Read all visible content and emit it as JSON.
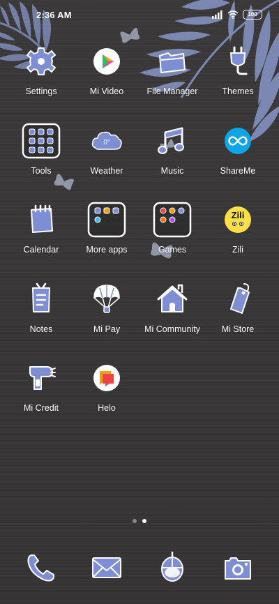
{
  "status_bar": {
    "time": "2:36 AM",
    "battery": "100",
    "signal_icon": "signal-icon",
    "wifi_icon": "wifi-icon"
  },
  "colors": {
    "icon_fill": "#7d8ed4",
    "icon_outline": "#ffffff",
    "leaf": "#8796c8",
    "butterfly": "#9aa1b2",
    "background": "#3a3838"
  },
  "apps": [
    {
      "label": "Settings",
      "icon": "gear-icon"
    },
    {
      "label": "Mi Video",
      "icon": "play-icon"
    },
    {
      "label": "File Manager",
      "icon": "folder-icon"
    },
    {
      "label": "Themes",
      "icon": "plug-icon"
    },
    {
      "label": "Tools",
      "icon": "folder-grid-icon"
    },
    {
      "label": "Weather",
      "icon": "cloud-icon",
      "badge": "0°"
    },
    {
      "label": "Music",
      "icon": "music-note-icon"
    },
    {
      "label": "ShareMe",
      "icon": "infinity-icon"
    },
    {
      "label": "Calendar",
      "icon": "calendar-icon"
    },
    {
      "label": "More apps",
      "icon": "folder-grid-icon"
    },
    {
      "label": "Games",
      "icon": "folder-grid-icon"
    },
    {
      "label": "Zili",
      "icon": "zili-logo-icon",
      "logo_text": "Zili"
    },
    {
      "label": "Notes",
      "icon": "notes-icon"
    },
    {
      "label": "Mi Pay",
      "icon": "parachute-icon"
    },
    {
      "label": "Mi Community",
      "icon": "house-icon"
    },
    {
      "label": "Mi Store",
      "icon": "tag-icon"
    },
    {
      "label": "Mi Credit",
      "icon": "hairdryer-icon"
    },
    {
      "label": "Helo",
      "icon": "chat-bubble-icon"
    }
  ],
  "page_indicator": {
    "count": 2,
    "active": 2
  },
  "dock": [
    {
      "icon": "phone-icon"
    },
    {
      "icon": "mail-icon"
    },
    {
      "icon": "mouse-icon"
    },
    {
      "icon": "camera-icon"
    }
  ]
}
